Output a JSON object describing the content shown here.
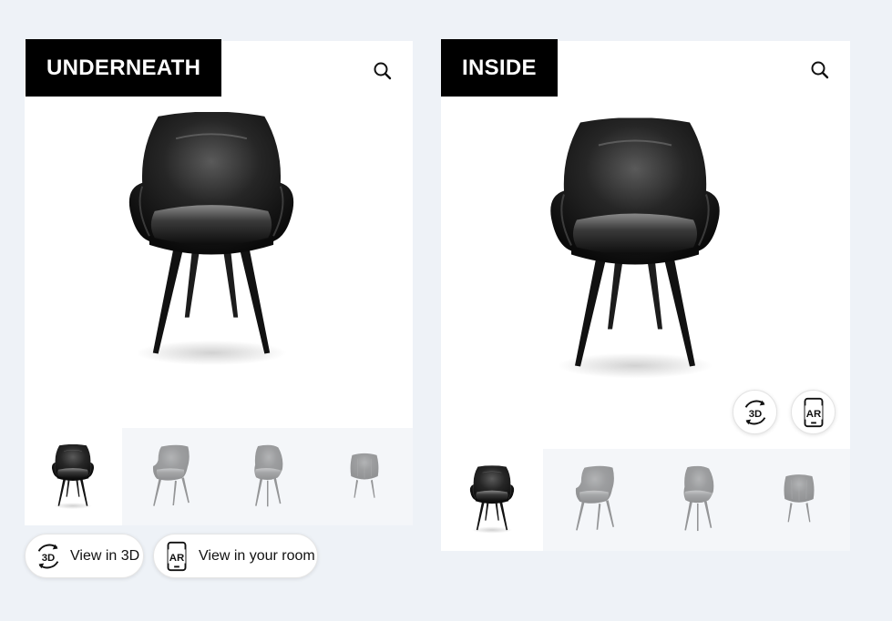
{
  "cards": [
    {
      "label": "UNDERNEATH",
      "zoom_icon": "search-icon",
      "main_image": "black-leather-armchair-front",
      "thumbnails": [
        {
          "view": "front",
          "active": true
        },
        {
          "view": "three-quarter",
          "active": false
        },
        {
          "view": "side",
          "active": false
        },
        {
          "view": "back",
          "active": false
        }
      ]
    },
    {
      "label": "INSIDE",
      "zoom_icon": "search-icon",
      "main_image": "black-leather-armchair-front",
      "round_buttons": {
        "three_d": "3D",
        "ar": "AR"
      },
      "thumbnails": [
        {
          "view": "front",
          "active": true
        },
        {
          "view": "three-quarter",
          "active": false
        },
        {
          "view": "side",
          "active": false
        },
        {
          "view": "back",
          "active": false
        }
      ]
    }
  ],
  "actions": {
    "view_3d": {
      "icon_text": "3D",
      "label": "View in 3D"
    },
    "view_ar": {
      "icon_text": "AR",
      "label": "View in your room"
    }
  },
  "colors": {
    "background": "#eef2f7",
    "badge": "#000000",
    "badge_text": "#ffffff",
    "thumb_bg": "#f4f6f9"
  }
}
